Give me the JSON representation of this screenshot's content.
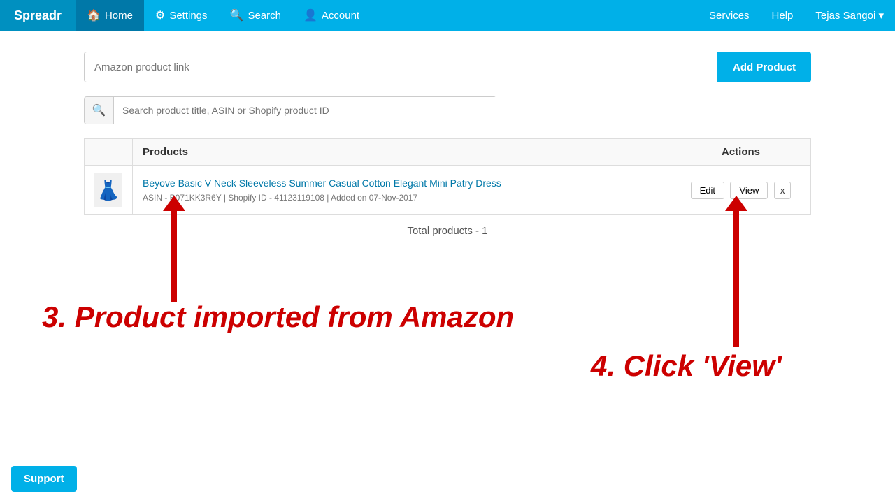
{
  "navbar": {
    "brand": "Spreadr",
    "items": [
      {
        "label": "Home",
        "icon": "🏠",
        "active": true
      },
      {
        "label": "Settings",
        "icon": "⚙"
      },
      {
        "label": "Search",
        "icon": "🔍"
      },
      {
        "label": "Account",
        "icon": "👤"
      }
    ],
    "right_items": [
      {
        "label": "Services"
      },
      {
        "label": "Help"
      },
      {
        "label": "Tejas Sangoi ▾"
      }
    ]
  },
  "add_product": {
    "input_placeholder": "Amazon product link",
    "button_label": "Add Product"
  },
  "search": {
    "placeholder": "Search product title, ASIN or Shopify product ID"
  },
  "table": {
    "headers": [
      "Products",
      "Actions"
    ],
    "rows": [
      {
        "title": "Beyove Basic V Neck Sleeveless Summer Casual Cotton Elegant Mini Patry Dress",
        "meta": "ASIN - B071KK3R6Y  |  Shopify ID - 41123119108  |  Added on 07-Nov-2017",
        "thumbnail": "👗"
      }
    ],
    "action_buttons": [
      "Edit",
      "View",
      "x"
    ],
    "total": "Total products - 1"
  },
  "annotations": {
    "text3": "3. Product imported from Amazon",
    "text4": "4. Click 'View'"
  },
  "support": {
    "label": "Support"
  }
}
